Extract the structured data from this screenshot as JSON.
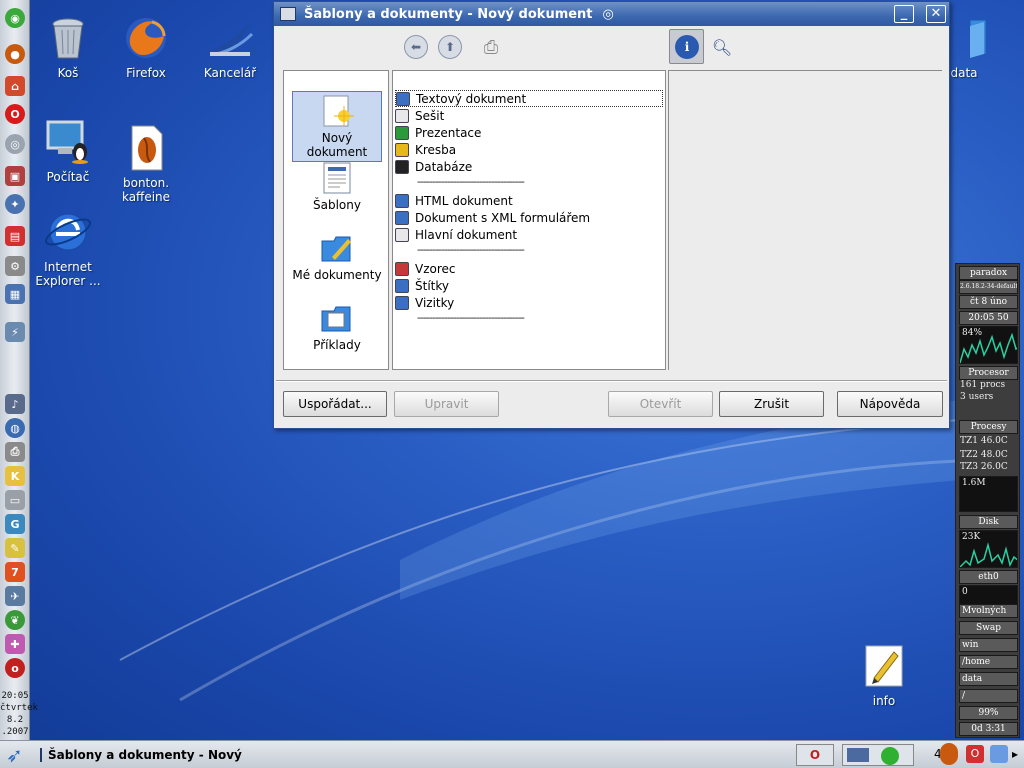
{
  "desktop": {
    "icons": [
      {
        "label": "Koš",
        "icon": "trash-icon"
      },
      {
        "label": "Firefox",
        "icon": "firefox-icon"
      },
      {
        "label": "Kancelář",
        "icon": "office-icon"
      },
      {
        "label": "Počítač",
        "icon": "computer-icon"
      },
      {
        "label": "bonton.\nkaffeine",
        "icon": "media-file-icon"
      },
      {
        "label": "Internet\nExplorer ...",
        "icon": "internet-explorer-icon"
      },
      {
        "label": "data",
        "icon": "folder-icon"
      },
      {
        "label": "info",
        "icon": "note-icon"
      }
    ]
  },
  "quickbar": {
    "clock": {
      "time": "20:05",
      "day": "čtvrtek",
      "date": "8.2",
      "year": ".2007"
    }
  },
  "dialog": {
    "title": "Šablony a dokumenty - Nový dokument",
    "toolbar": [
      "back-icon",
      "up-icon",
      "print-icon",
      "info-icon",
      "preview-icon"
    ],
    "categories": [
      {
        "label": "Nový dokument",
        "selected": true
      },
      {
        "label": "Šablony",
        "selected": false
      },
      {
        "label": "Mé dokumenty",
        "selected": false
      },
      {
        "label": "Příklady",
        "selected": false
      }
    ],
    "items": [
      {
        "label": "Textový dokument",
        "color": "#3a6fc4"
      },
      {
        "label": "Sešit",
        "color": "#e8e8e8"
      },
      {
        "label": "Prezentace",
        "color": "#2a9a3a"
      },
      {
        "label": "Kresba",
        "color": "#e6b81c"
      },
      {
        "label": "Databáze",
        "color": "#222222"
      },
      {
        "label": "HTML dokument",
        "color": "#3a6fc4"
      },
      {
        "label": "Dokument s XML formulářem",
        "color": "#3a6fc4"
      },
      {
        "label": "Hlavní dokument",
        "color": "#e8e8e8"
      },
      {
        "label": "Vzorec",
        "color": "#c43a3a"
      },
      {
        "label": "Štítky",
        "color": "#3a6fc4"
      },
      {
        "label": "Vizitky",
        "color": "#3a6fc4"
      }
    ],
    "separator": "------------------------------------",
    "buttons": {
      "organize": "Uspořádat...",
      "edit": "Upravit",
      "open": "Otevřít",
      "cancel": "Zrušit",
      "help": "Nápověda"
    }
  },
  "monitor": {
    "host": "paradox",
    "kernel": "2.6.18.2-34-default",
    "date": "čt 8 úno",
    "time": "20:05 50",
    "cpu_percent": "84%",
    "proc_title": "Procesor",
    "procs": "161 procs",
    "users": "3 users",
    "processes_title": "Procesy",
    "temps": [
      {
        "label": "TZ1",
        "value": "46.0C"
      },
      {
        "label": "TZ2",
        "value": "48.0C"
      },
      {
        "label": "TZ3",
        "value": "26.0C"
      }
    ],
    "mem": "1.6M",
    "disk_title": "Disk",
    "disk": "23K",
    "net": "eth0",
    "net_value": "0",
    "mounts": [
      "Mvolných",
      "Swap",
      "win",
      "/home",
      "data",
      "/"
    ],
    "battery": "99%",
    "uptime": "0d 3:31"
  },
  "taskbar": {
    "task_label": "Šablony a dokumenty - Nový do",
    "tray_num": "4"
  }
}
